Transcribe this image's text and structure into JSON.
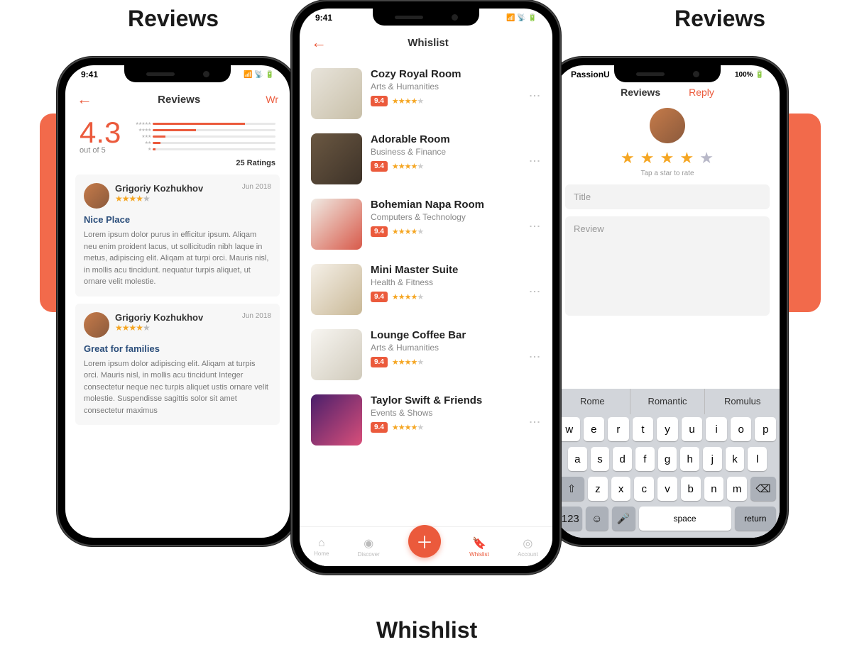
{
  "sectionTitles": {
    "left": "Reviews",
    "right": "Reviews",
    "center": "Whishlist"
  },
  "status": {
    "time": "9:41",
    "signal": "●●●●",
    "wifi": "⦿",
    "battery": "■",
    "carrier": "PassionU",
    "pct": "100%"
  },
  "phoneLeft": {
    "header": {
      "title": "Reviews",
      "link": "Wr"
    },
    "rating": {
      "value": "4.3",
      "outOf": "out of 5",
      "count": "25 Ratings",
      "bars": [
        {
          "stars": "★★★★★",
          "pct": 75
        },
        {
          "stars": "★★★★",
          "pct": 35
        },
        {
          "stars": "★★★",
          "pct": 10
        },
        {
          "stars": "★★",
          "pct": 6
        },
        {
          "stars": "★",
          "pct": 2
        }
      ]
    },
    "reviews": [
      {
        "name": "Grigoriy Kozhukhov",
        "stars": 4,
        "date": "Jun 2018",
        "title": "Nice Place",
        "body": "Lorem ipsum dolor purus in efficitur ipsum. Aliqam neu enim proident lacus, ut sollicitudin nibh laque in metus, adipiscing elit. Aliqam at turpi orci. Mauris nisl, in mollis acu tincidunt. nequatur turpis aliquet, ut ornare velit molestie."
      },
      {
        "name": "Grigoriy Kozhukhov",
        "stars": 4,
        "date": "Jun 2018",
        "title": "Great for families",
        "body": "Lorem ipsum dolor adipiscing elit. Aliqam at turpis orci. Mauris nisl, in mollis acu tincidunt Integer consectetur neque nec turpis aliquet ustis ornare velit molestie. Suspendisse sagittis solor sit amet consectetur maximus"
      }
    ]
  },
  "phoneCenter": {
    "header": {
      "title": "Whislist"
    },
    "items": [
      {
        "title": "Cozy Royal Room",
        "cat": "Arts & Humanities",
        "badge": "9.4",
        "stars": 4,
        "thumbCls": "thumb1"
      },
      {
        "title": "Adorable Room",
        "cat": "Business & Finance",
        "badge": "9.4",
        "stars": 4,
        "thumbCls": "thumb2"
      },
      {
        "title": "Bohemian Napa Room",
        "cat": "Computers & Technology",
        "badge": "9.4",
        "stars": 4,
        "thumbCls": "thumb3"
      },
      {
        "title": "Mini Master Suite",
        "cat": "Health & Fitness",
        "badge": "9.4",
        "stars": 4,
        "thumbCls": "thumb4"
      },
      {
        "title": "Lounge Coffee Bar",
        "cat": "Arts & Humanities",
        "badge": "9.4",
        "stars": 4,
        "thumbCls": "thumb5"
      },
      {
        "title": "Taylor Swift & Friends",
        "cat": "Events & Shows",
        "badge": "9.4",
        "stars": 4,
        "thumbCls": "thumb6"
      }
    ],
    "tabs": [
      {
        "icon": "⌂",
        "label": "Home"
      },
      {
        "icon": "◉",
        "label": "Discover"
      },
      {
        "icon": "＋",
        "label": ""
      },
      {
        "icon": "🔖",
        "label": "Whislist",
        "active": true
      },
      {
        "icon": "◎",
        "label": "Account"
      }
    ]
  },
  "phoneRight": {
    "tabs": {
      "left": "Reviews",
      "right": "Reply"
    },
    "hint": "Tap a star to rate",
    "stars": 4,
    "titlePlaceholder": "Title",
    "reviewPlaceholder": "Review",
    "suggestions": [
      "Rome",
      "Romantic",
      "Romulus"
    ],
    "keyboard": {
      "row1": [
        "w",
        "e",
        "r",
        "t",
        "y",
        "u",
        "i",
        "o",
        "p"
      ],
      "row2": [
        "a",
        "s",
        "d",
        "f",
        "g",
        "h",
        "j",
        "k",
        "l"
      ],
      "row3": [
        "z",
        "x",
        "c",
        "v",
        "b",
        "n",
        "m"
      ],
      "shift": "⇧",
      "backspace": "⌫",
      "num": "123",
      "emoji": "☺",
      "mic": "🎤",
      "space": "space",
      "ret": "return"
    }
  }
}
